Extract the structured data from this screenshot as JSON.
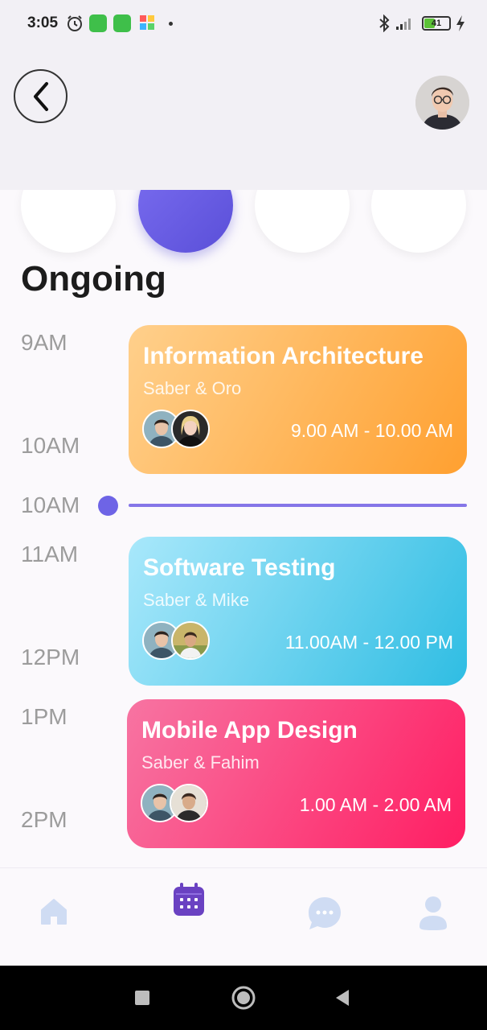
{
  "status_bar": {
    "time": "3:05",
    "battery_level": "41",
    "icons": [
      "alarm-icon",
      "app-icon",
      "app-icon",
      "puzzle-icon",
      "bluetooth-icon",
      "signal-icon",
      "battery-icon",
      "charging-icon"
    ]
  },
  "header": {
    "back_icon": "chevron-left-icon",
    "avatar": "user-avatar"
  },
  "page": {
    "title": "Ongoing"
  },
  "timeline": {
    "labels": [
      "9AM",
      "10AM",
      "10AM",
      "11AM",
      "12PM",
      "1PM",
      "2PM"
    ]
  },
  "sessions": [
    {
      "title": "Information Architecture",
      "participants": "Saber & Oro",
      "time": "9.00 AM - 10.00 AM",
      "colors": [
        "#ffcf8a",
        "#ffa02e"
      ]
    },
    {
      "title": "Software Testing",
      "participants": "Saber & Mike",
      "time": "11.00AM - 12.00 PM",
      "colors": [
        "#a8e8fb",
        "#2fbde3"
      ]
    },
    {
      "title": "Mobile App Design",
      "participants": "Saber & Fahim",
      "time": "1.00 AM - 2.00 AM",
      "colors": [
        "#f772a0",
        "#ff1e63"
      ]
    }
  ],
  "nav": {
    "items": [
      "home-icon",
      "calendar-icon",
      "chat-icon",
      "profile-icon"
    ],
    "active": "calendar-icon",
    "active_color": "#6a42c2",
    "inactive_color": "#cfdcf3"
  },
  "system_nav": [
    "square-icon",
    "circle-icon",
    "triangle-back-icon"
  ]
}
